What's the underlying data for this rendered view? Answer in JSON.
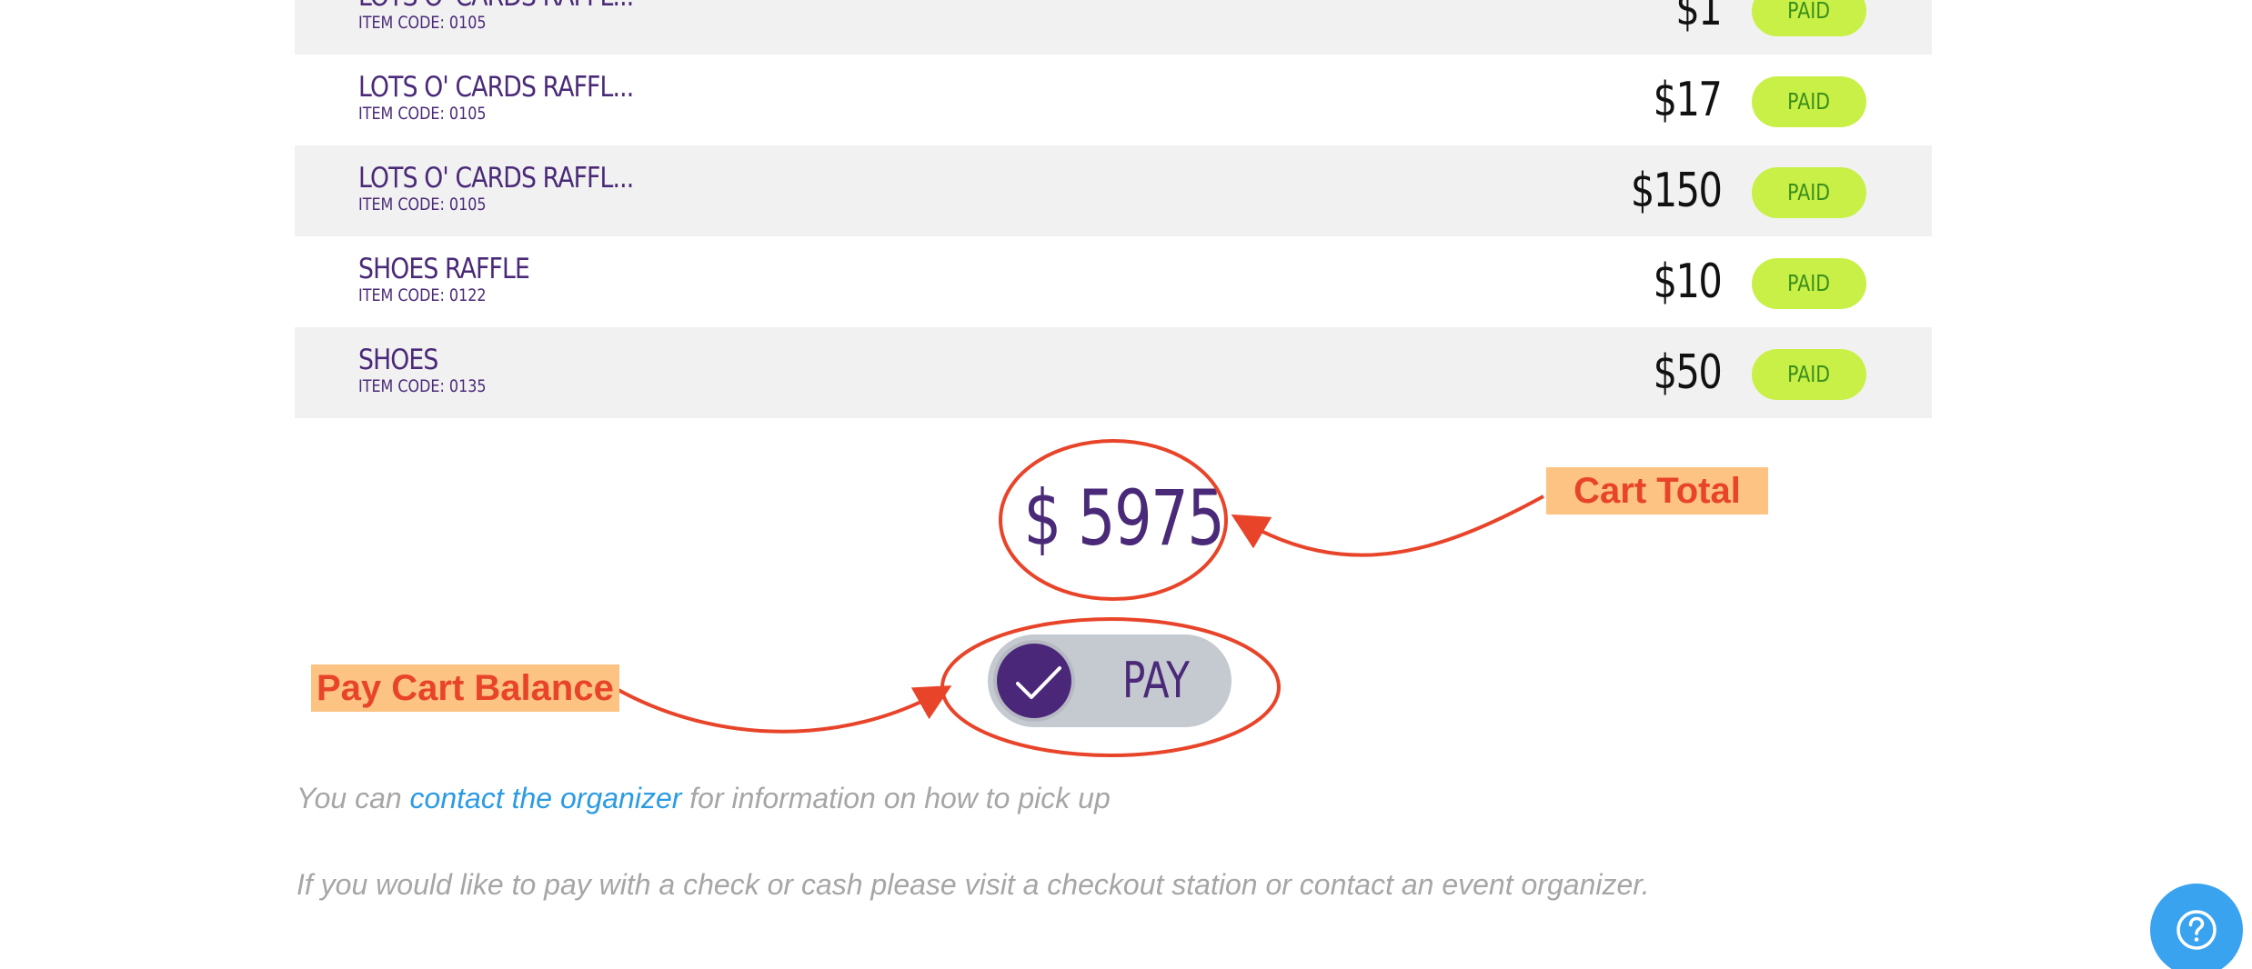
{
  "items": [
    {
      "name": "LOTS O' CARDS RAFFL...",
      "code": "ITEM CODE: 0105",
      "price": "$1",
      "status": "PAID"
    },
    {
      "name": "LOTS O' CARDS RAFFL...",
      "code": "ITEM CODE: 0105",
      "price": "$17",
      "status": "PAID"
    },
    {
      "name": "LOTS O' CARDS RAFFL...",
      "code": "ITEM CODE: 0105",
      "price": "$150",
      "status": "PAID"
    },
    {
      "name": "SHOES RAFFLE",
      "code": "ITEM CODE: 0122",
      "price": "$10",
      "status": "PAID"
    },
    {
      "name": "SHOES",
      "code": "ITEM CODE: 0135",
      "price": "$50",
      "status": "PAID"
    }
  ],
  "cart": {
    "total": "$ 5975",
    "pay_label": "PAY",
    "pay_checked": true
  },
  "annotations": {
    "cart_total": "Cart Total",
    "pay_cart_balance": "Pay Cart Balance"
  },
  "notes": {
    "pickup_prefix": "You can ",
    "pickup_link": "contact the organizer",
    "pickup_suffix": " for information on how to pick up",
    "payment": "If you would like to pay with a check or cash please visit a checkout station or contact an event organizer."
  },
  "icons": {
    "pay_toggle": "check-icon",
    "help": "question-mark-icon"
  },
  "colors": {
    "brand_purple": "#4a2a78",
    "paid_badge": "#c8f046",
    "paid_text": "#3c8f1e",
    "annotation_red": "#e8442a",
    "annotation_fill": "#fdc383",
    "link_blue": "#2b9be4",
    "help_button": "#3aa3ef"
  }
}
